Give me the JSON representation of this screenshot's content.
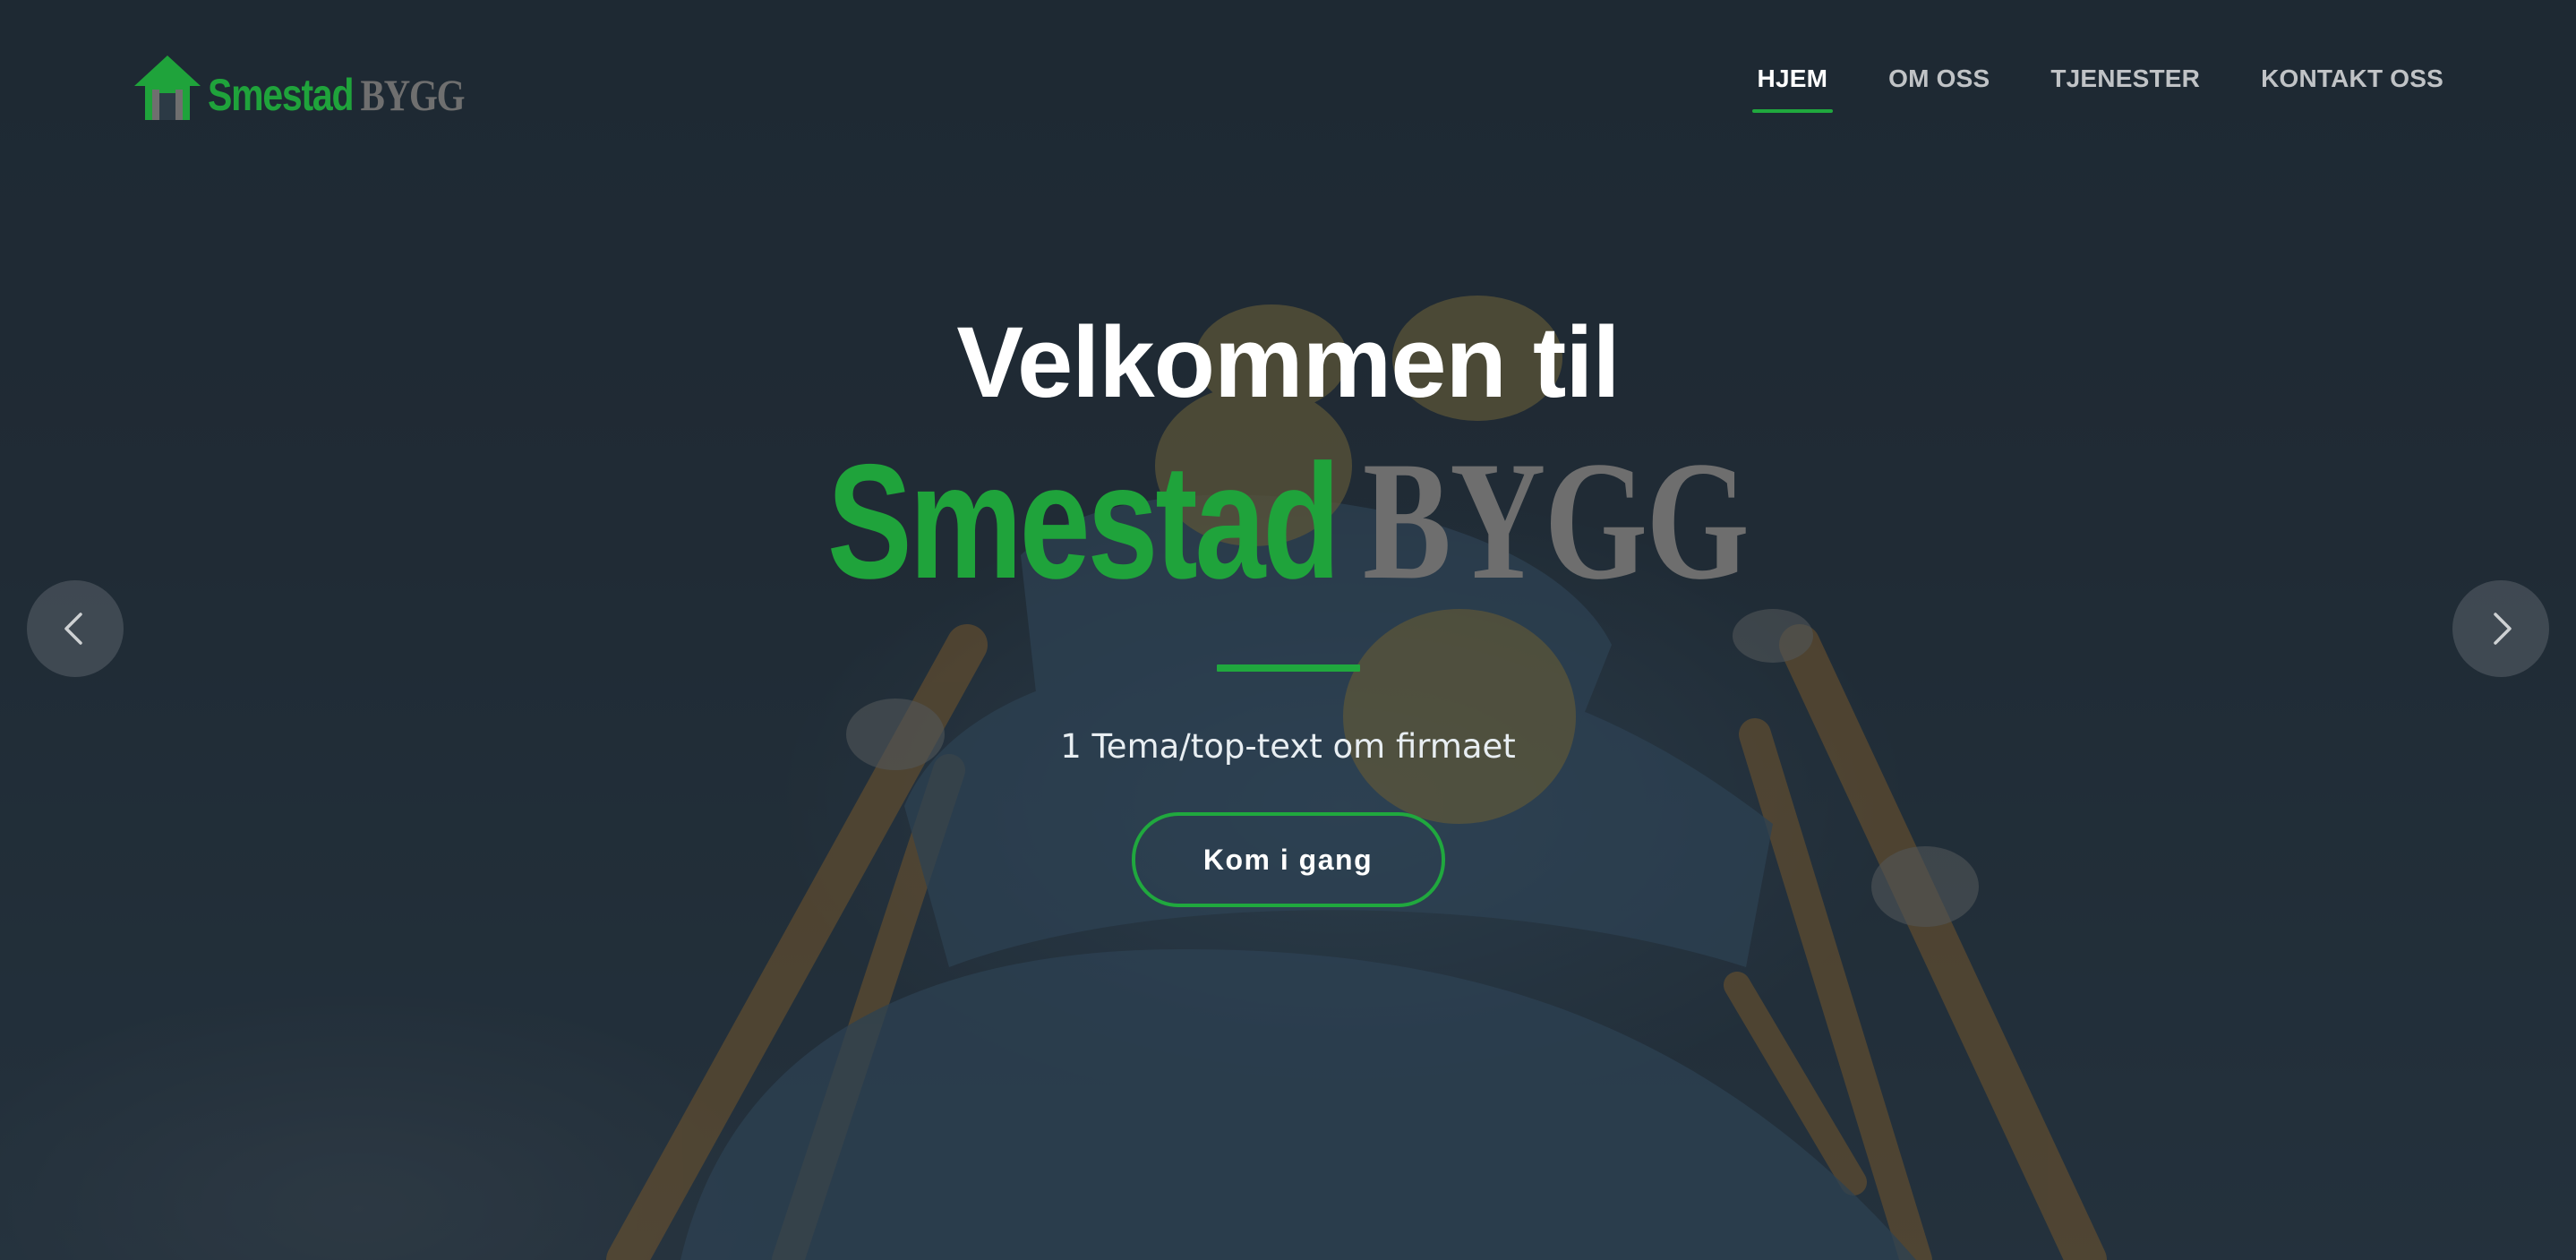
{
  "navbar": {
    "logo": {
      "primary": "Smestad",
      "secondary": "BYGG"
    },
    "items": [
      {
        "label": "HJEM",
        "active": true
      },
      {
        "label": "OM OSS",
        "active": false
      },
      {
        "label": "TJENESTER",
        "active": false
      },
      {
        "label": "KONTAKT OSS",
        "active": false
      }
    ]
  },
  "hero": {
    "welcome": "Velkommen til",
    "brand_primary": "Smestad",
    "brand_secondary": "BYGG",
    "tagline": "1 Tema/top-text om firmaet",
    "cta_label": "Kom i gang"
  },
  "carousel": {
    "prev_icon": "chevron-left-icon",
    "next_icon": "chevron-right-icon"
  },
  "colors": {
    "accent": "#20a83e",
    "brand_green": "#1fa33b",
    "brand_grey": "#6e6e6e",
    "overlay": "#182129"
  }
}
